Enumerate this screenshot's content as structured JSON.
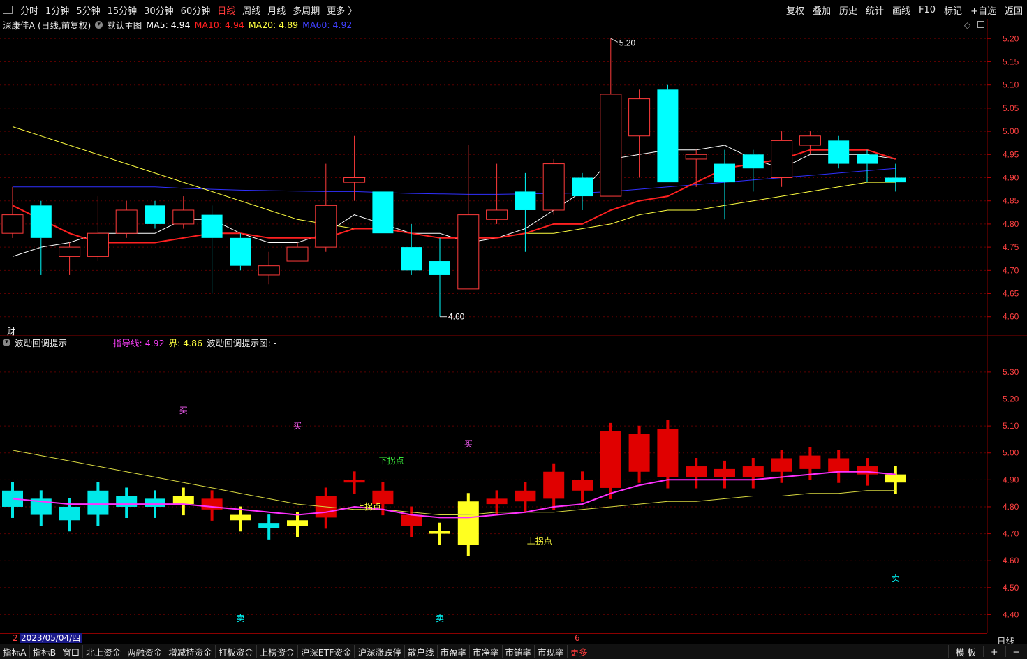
{
  "toolbar": {
    "periods": [
      "分时",
      "1分钟",
      "5分钟",
      "15分钟",
      "30分钟",
      "60分钟",
      "日线",
      "周线",
      "月线",
      "多周期",
      "更多 〉"
    ],
    "active_period": "日线",
    "right_items": [
      "复权",
      "叠加",
      "历史",
      "统计",
      "画线",
      "F10",
      "标记",
      "+自选",
      "返回"
    ]
  },
  "main_info": {
    "stock": "深康佳A (日线,前复权)",
    "template": "默认主图",
    "ma5": "MA5: 4.94",
    "ma10": "MA10: 4.94",
    "ma20": "MA20: 4.89",
    "ma60": "MA60: 4.92",
    "colors": {
      "ma5": "#ffffff",
      "ma10": "#ff2020",
      "ma20": "#ffff40",
      "ma60": "#4040ff"
    }
  },
  "main_annotations": {
    "high": "5.20",
    "low": "4.60",
    "finance_mark": "财"
  },
  "indicator_info": {
    "name": "波动回调提示",
    "guide": "指导线: 4.92",
    "bound": "界: 4.86",
    "hint": "波动回调提示图: -"
  },
  "indicator_labels": {
    "buy": "买",
    "sell": "卖",
    "down_turn": "下拐点",
    "up_turn": "上拐点"
  },
  "main_axis": [
    "5.20",
    "5.15",
    "5.10",
    "5.05",
    "5.00",
    "4.95",
    "4.90",
    "4.85",
    "4.80",
    "4.75",
    "4.70",
    "4.65",
    "4.60"
  ],
  "ind_axis": [
    "5.30",
    "5.20",
    "5.10",
    "5.00",
    "4.90",
    "4.80",
    "4.70",
    "4.60",
    "4.50",
    "4.40"
  ],
  "chart_data": {
    "type": "candlestick",
    "candles": [
      {
        "o": 4.78,
        "c": 4.82,
        "h": 4.88,
        "l": 4.77
      },
      {
        "o": 4.84,
        "c": 4.77,
        "h": 4.85,
        "l": 4.69
      },
      {
        "o": 4.73,
        "c": 4.75,
        "h": 4.76,
        "l": 4.69
      },
      {
        "o": 4.73,
        "c": 4.78,
        "h": 4.86,
        "l": 4.72
      },
      {
        "o": 4.78,
        "c": 4.83,
        "h": 4.85,
        "l": 4.77
      },
      {
        "o": 4.84,
        "c": 4.8,
        "h": 4.85,
        "l": 4.79
      },
      {
        "o": 4.8,
        "c": 4.83,
        "h": 4.86,
        "l": 4.79
      },
      {
        "o": 4.82,
        "c": 4.77,
        "h": 4.84,
        "l": 4.65
      },
      {
        "o": 4.77,
        "c": 4.71,
        "h": 4.78,
        "l": 4.7
      },
      {
        "o": 4.69,
        "c": 4.71,
        "h": 4.74,
        "l": 4.67
      },
      {
        "o": 4.72,
        "c": 4.75,
        "h": 4.76,
        "l": 4.72
      },
      {
        "o": 4.75,
        "c": 4.84,
        "h": 4.93,
        "l": 4.74
      },
      {
        "o": 4.89,
        "c": 4.9,
        "h": 4.99,
        "l": 4.85
      },
      {
        "o": 4.87,
        "c": 4.78,
        "h": 4.87,
        "l": 4.78
      },
      {
        "o": 4.75,
        "c": 4.7,
        "h": 4.8,
        "l": 4.69
      },
      {
        "o": 4.72,
        "c": 4.69,
        "h": 4.77,
        "l": 4.6
      },
      {
        "o": 4.66,
        "c": 4.82,
        "h": 4.97,
        "l": 4.66
      },
      {
        "o": 4.81,
        "c": 4.83,
        "h": 4.93,
        "l": 4.8
      },
      {
        "o": 4.87,
        "c": 4.83,
        "h": 4.91,
        "l": 4.74
      },
      {
        "o": 4.83,
        "c": 4.93,
        "h": 4.94,
        "l": 4.82
      },
      {
        "o": 4.9,
        "c": 4.86,
        "h": 4.91,
        "l": 4.83
      },
      {
        "o": 4.86,
        "c": 5.08,
        "h": 5.2,
        "l": 4.86
      },
      {
        "o": 4.99,
        "c": 5.07,
        "h": 5.09,
        "l": 4.9
      },
      {
        "o": 5.09,
        "c": 4.89,
        "h": 5.1,
        "l": 4.89
      },
      {
        "o": 4.94,
        "c": 4.95,
        "h": 4.96,
        "l": 4.88
      },
      {
        "o": 4.93,
        "c": 4.89,
        "h": 4.96,
        "l": 4.81
      },
      {
        "o": 4.95,
        "c": 4.92,
        "h": 4.96,
        "l": 4.87
      },
      {
        "o": 4.9,
        "c": 4.98,
        "h": 5.0,
        "l": 4.88
      },
      {
        "o": 4.97,
        "c": 4.99,
        "h": 5.0,
        "l": 4.95
      },
      {
        "o": 4.98,
        "c": 4.93,
        "h": 4.99,
        "l": 4.92
      },
      {
        "o": 4.95,
        "c": 4.93,
        "h": 4.96,
        "l": 4.89
      },
      {
        "o": 4.9,
        "c": 4.89,
        "h": 4.93,
        "l": 4.87
      }
    ],
    "ma5": [
      4.73,
      4.75,
      4.76,
      4.78,
      4.78,
      4.78,
      4.81,
      4.81,
      4.78,
      4.76,
      4.76,
      4.78,
      4.82,
      4.8,
      4.78,
      4.78,
      4.76,
      4.77,
      4.79,
      4.83,
      4.87,
      4.94,
      4.95,
      4.96,
      4.96,
      4.97,
      4.94,
      4.92,
      4.95,
      4.95,
      4.95,
      4.94
    ],
    "ma10": [
      4.84,
      4.81,
      4.78,
      4.76,
      4.76,
      4.76,
      4.77,
      4.78,
      4.78,
      4.77,
      4.77,
      4.77,
      4.79,
      4.79,
      4.78,
      4.77,
      4.77,
      4.77,
      4.78,
      4.8,
      4.8,
      4.83,
      4.85,
      4.86,
      4.89,
      4.92,
      4.93,
      4.94,
      4.96,
      4.96,
      4.96,
      4.94
    ],
    "ma20": [
      5.01,
      4.99,
      4.97,
      4.95,
      4.93,
      4.91,
      4.89,
      4.87,
      4.85,
      4.83,
      4.81,
      4.8,
      4.79,
      4.79,
      4.78,
      4.77,
      4.77,
      4.77,
      4.78,
      4.78,
      4.79,
      4.8,
      4.82,
      4.83,
      4.83,
      4.84,
      4.85,
      4.86,
      4.87,
      4.88,
      4.89,
      4.89
    ],
    "ma60": [
      4.88,
      4.88,
      4.88,
      4.88,
      4.88,
      4.88,
      4.877,
      4.875,
      4.873,
      4.872,
      4.871,
      4.87,
      4.87,
      4.868,
      4.866,
      4.865,
      4.864,
      4.864,
      4.865,
      4.866,
      4.867,
      4.87,
      4.875,
      4.88,
      4.885,
      4.89,
      4.895,
      4.9,
      4.905,
      4.91,
      4.915,
      4.92
    ],
    "guide_line": [
      4.83,
      4.82,
      4.81,
      4.81,
      4.81,
      4.81,
      4.81,
      4.8,
      4.79,
      4.78,
      4.77,
      4.78,
      4.8,
      4.79,
      4.77,
      4.76,
      4.76,
      4.77,
      4.78,
      4.8,
      4.81,
      4.85,
      4.88,
      4.9,
      4.9,
      4.9,
      4.9,
      4.91,
      4.92,
      4.93,
      4.93,
      4.92
    ],
    "bound_line": [
      5.01,
      4.99,
      4.97,
      4.95,
      4.93,
      4.91,
      4.89,
      4.87,
      4.85,
      4.83,
      4.81,
      4.8,
      4.79,
      4.79,
      4.78,
      4.77,
      4.77,
      4.78,
      4.78,
      4.78,
      4.79,
      4.8,
      4.81,
      4.82,
      4.82,
      4.83,
      4.84,
      4.84,
      4.85,
      4.85,
      4.86,
      4.86
    ],
    "ind_bars": [
      {
        "top": 4.86,
        "bot": 4.8,
        "kind": "cyan"
      },
      {
        "top": 4.83,
        "bot": 4.77,
        "kind": "cyan"
      },
      {
        "top": 4.8,
        "bot": 4.75,
        "kind": "cyan"
      },
      {
        "top": 4.86,
        "bot": 4.77,
        "kind": "cyan"
      },
      {
        "top": 4.84,
        "bot": 4.8,
        "kind": "cyan"
      },
      {
        "top": 4.83,
        "bot": 4.8,
        "kind": "cyan"
      },
      {
        "top": 4.84,
        "bot": 4.81,
        "kind": "yellow"
      },
      {
        "top": 4.83,
        "bot": 4.79,
        "kind": "red"
      },
      {
        "top": 4.77,
        "bot": 4.75,
        "kind": "yellow"
      },
      {
        "top": 4.74,
        "bot": 4.72,
        "kind": "cyan"
      },
      {
        "top": 4.75,
        "bot": 4.73,
        "kind": "yellow"
      },
      {
        "top": 4.84,
        "bot": 4.76,
        "kind": "red"
      },
      {
        "top": 4.9,
        "bot": 4.89,
        "kind": "red"
      },
      {
        "top": 4.86,
        "bot": 4.81,
        "kind": "red"
      },
      {
        "top": 4.77,
        "bot": 4.73,
        "kind": "red"
      },
      {
        "top": 4.71,
        "bot": 4.7,
        "kind": "yellow"
      },
      {
        "top": 4.82,
        "bot": 4.66,
        "kind": "yellow"
      },
      {
        "top": 4.83,
        "bot": 4.81,
        "kind": "red"
      },
      {
        "top": 4.86,
        "bot": 4.82,
        "kind": "red"
      },
      {
        "top": 4.93,
        "bot": 4.83,
        "kind": "red"
      },
      {
        "top": 4.9,
        "bot": 4.86,
        "kind": "red"
      },
      {
        "top": 5.08,
        "bot": 4.87,
        "kind": "red"
      },
      {
        "top": 5.07,
        "bot": 4.93,
        "kind": "red"
      },
      {
        "top": 5.09,
        "bot": 4.91,
        "kind": "red"
      },
      {
        "top": 4.95,
        "bot": 4.91,
        "kind": "red"
      },
      {
        "top": 4.94,
        "bot": 4.91,
        "kind": "red"
      },
      {
        "top": 4.95,
        "bot": 4.91,
        "kind": "red"
      },
      {
        "top": 4.98,
        "bot": 4.93,
        "kind": "red"
      },
      {
        "top": 4.99,
        "bot": 4.94,
        "kind": "red"
      },
      {
        "top": 4.98,
        "bot": 4.93,
        "kind": "red"
      },
      {
        "top": 4.95,
        "bot": 4.92,
        "kind": "red"
      },
      {
        "top": 4.92,
        "bot": 4.89,
        "kind": "yellow"
      }
    ],
    "buy_marks": [
      6,
      10,
      16
    ],
    "sell_marks": [
      8,
      15,
      31
    ],
    "main_ylim": [
      4.58,
      5.22
    ],
    "ind_ylim": [
      4.37,
      5.38
    ]
  },
  "date_label": "2023/05/04/四",
  "date_mark": "6",
  "period_label": "日线",
  "bottom_tabs": [
    "指标A",
    "指标B",
    "窗口",
    "北上资金",
    "两融资金",
    "增减持资金",
    "打板资金",
    "上榜资金",
    "沪深ETF资金",
    "沪深涨跌停",
    "散户线",
    "市盈率",
    "市净率",
    "市销率",
    "市现率",
    "更多"
  ],
  "bottom_right": [
    "模 板",
    "+",
    "−"
  ]
}
